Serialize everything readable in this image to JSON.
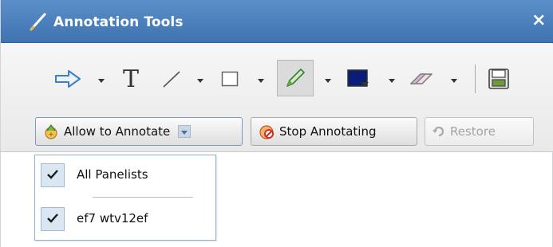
{
  "window": {
    "title": "Annotation Tools",
    "close_label": "×"
  },
  "toolbar": {
    "tools": [
      {
        "name": "pointer",
        "icon": "arrow-right-icon",
        "has_dropdown": true
      },
      {
        "name": "text",
        "icon": "text-icon",
        "has_dropdown": false
      },
      {
        "name": "line",
        "icon": "line-icon",
        "has_dropdown": true
      },
      {
        "name": "rectangle",
        "icon": "rectangle-icon",
        "has_dropdown": true
      },
      {
        "name": "highlighter",
        "icon": "highlighter-pen-icon",
        "has_dropdown": true,
        "selected": true
      },
      {
        "name": "color",
        "icon": "color-swatch-icon",
        "has_dropdown": true,
        "color": "#0a1e78"
      },
      {
        "name": "eraser",
        "icon": "eraser-icon",
        "has_dropdown": true
      },
      {
        "name": "save",
        "icon": "floppy-disk-icon",
        "has_dropdown": false
      }
    ],
    "text_tool_glyph": "T"
  },
  "actions": {
    "allow_label": "Allow to Annotate",
    "stop_label": "Stop Annotating",
    "restore_label": "Restore"
  },
  "menu": {
    "items": [
      {
        "label": "All Panelists",
        "checked": true
      },
      {
        "label": "ef7 wtv12ef",
        "checked": true
      }
    ]
  },
  "colors": {
    "title_bar": "#4a7fbd",
    "accent_blue": "#3f73b1",
    "selected_color": "#0a1e78"
  }
}
